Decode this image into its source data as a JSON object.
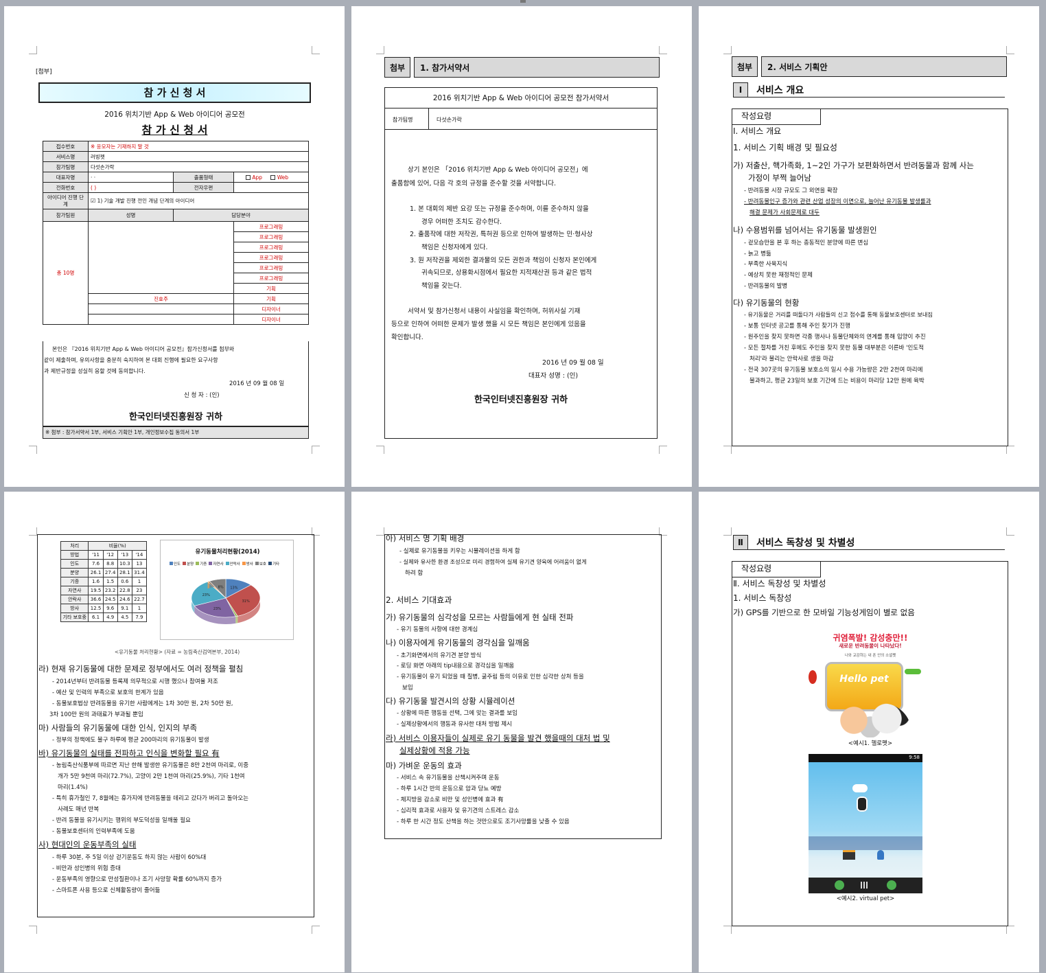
{
  "p1": {
    "attach": "[첨부]",
    "box_title": "참 가 신 청 서",
    "contest": "2016 위치기반 App & Web 아이디어 공모전",
    "title": "참 가 신 청 서",
    "l_receipt": "접수번호",
    "v_receipt": "※ 응모자는 기재하지 말 것",
    "l_service": "서비스명",
    "v_service": "러빙펫",
    "l_team": "참가팀명",
    "v_team": "다섯손가락",
    "l_rep": "대표자명",
    "v_rep": "· ·",
    "l_type": "출품형태",
    "v_app": "App",
    "v_web": "Web",
    "l_phone": "전화번호",
    "v_phone": "(      )",
    "l_email": "전자우편",
    "l_idea": "아이디어 진행 단계",
    "v_idea": "1) 기술 개발 진행 전인 개념 단계의 아이디어",
    "l_member": "참가팀원",
    "h_name": "성명",
    "h_role": "담당분야",
    "count": "총 10명",
    "role_prog": "프로그래밍",
    "role_plan": "기획",
    "role_design": "디자이너",
    "leader": "진효주",
    "pledge1": "본인은 『2016 위치기반 App & Web 아이디어 공모전』참가신청서를 첨부와",
    "pledge2": "같이 제출하며, 유의사항을 충분히 숙지하여 본 대회 진행에 필요한 요구사항",
    "pledge3": "과 제반규정을 성실히 응할 것에 동의합니다.",
    "date": "2016 년   09 월  08 일",
    "applicant": "신   청   자 :                            (인)",
    "to": "한국인터넷진흥원장 귀하",
    "footer": "※ 첨부 : 참가서약서 1부, 서비스 기획안 1부, 개인정보수집 동의서 1부"
  },
  "p2": {
    "tag": "첨부",
    "head": "1. 참가서약서",
    "title": "2016 위치기반 App & Web 아이디어 공모전 참가서약서",
    "l_team": "참가팀명",
    "v_team": "다섯손가락",
    "p1a": "상기 본인은 「2016 위치기반 App & Web 아이디어 공모전」에",
    "p1b": "출품함에 있어, 다음 각 호의  규정을 준수할 것을 서약합니다.",
    "i1a": "1. 본 대회의 제반 요강 또는 규정을 준수하며, 이를 준수하지 않을",
    "i1b": "경우 어떠한 조치도 감수한다.",
    "i2a": "2. 출품작에 대한 저작권, 특허권 등으로 인하여 발생하는 민·형사상",
    "i2b": "책임은 신청자에게 있다.",
    "i3a": "3. 원 저작권을 제외한 결과물의 모든 권한과 책임이 신청자 본인에게",
    "i3b": "귀속되므로, 상용화시점에서 필요한 지적재산권 등과 같은 법적",
    "i3c": "책임을 갖는다.",
    "p2a": "서약서 및 참가신청서 내용이 사실임을 확인하며, 허위사실 기재",
    "p2b": "등으로 인하여 어떠한  문제가 발생 했을 시 모든 책임은 본인에게 있음을",
    "p2c": "확인합니다.",
    "date": "2016  년    09  월     08  일",
    "rep": "대표자  성명 :                 (인)",
    "to": "한국인터넷진흥원장 귀하"
  },
  "p3": {
    "tag": "첨부",
    "head": "2. 서비스 기획안",
    "roman": "Ⅰ",
    "roman_title": "서비스 개요",
    "yoryeong": "작성요령",
    "s1": "Ⅰ. 서비스 개요",
    "s2": "1. 서비스 기획 배경 및 필요성",
    "ga1": "가) 저출산, 핵가족화, 1~2인 가구가 보편화하면서 반려동물과 함께 사는",
    "ga2": "가정이 부쩍 늘어남",
    "ga_b1": "- 반려동물 시장 규모도 그 외연을 확장",
    "ga_b2": "- 반려동물인구 증가와 관련 산업 성장의 이면으로, 늘어난 유기동물 발생률과",
    "ga_b3": "해결 문제가 사회문제로 대두",
    "na": "나) 수용범위를 넘어서는 유기동물 발생원인",
    "na_b1": "- 겉모습만을 본 후 하는 충동적인 분양에 따른 변심",
    "na_b2": "- 늙고 병듦",
    "na_b3": "- 부족한 사육지식",
    "na_b4": "- 예상치 못한 재정적인 문제",
    "na_b5": "- 반려동물의 발병",
    "da": "다) 유기동물의 현황",
    "da_b1": "- 유기동물은 거리를 떠돌다가 사람들의 신고 접수를 통해 동물보호센터로 보내짐",
    "da_b2": "- 보통 인터넷 공고를 통해 주인 찾기가 진행",
    "da_b3": "- 원주인을 찾지 못하면 각종 행사나 동물단체와의 연계를 통해 입양이 추진",
    "da_b4": "- 모든 절차를 거친 후에도 주인을 찾지 못한 동물 대부분은 이른바 '인도적",
    "da_b5": "처리'라 불리는 안락사로 생을 마감",
    "da_b6": "- 전국 307곳의 유기동물 보호소의 일시 수용 가능량은 2만 2천여 마리에",
    "da_b7": "불과하고, 평균 23일의 보호 기간에 드는 비용이 마리당 12만 원에 육박"
  },
  "p4": {
    "table_header": [
      "처리",
      "비율(%)"
    ],
    "table_sub": [
      "방법",
      "'11",
      "'12",
      "'13",
      "'14"
    ],
    "table_rows": [
      [
        "인도",
        "7.6",
        "8.8",
        "10.3",
        "13"
      ],
      [
        "분양",
        "26.1",
        "27.4",
        "28.1",
        "31.4"
      ],
      [
        "기증",
        "1.6",
        "1.5",
        "0.6",
        "1"
      ],
      [
        "자연사",
        "19.5",
        "23.2",
        "22.8",
        "23"
      ],
      [
        "안락사",
        "36.6",
        "24.5",
        "24.6",
        "22.7"
      ],
      [
        "방사",
        "12.5",
        "9.6",
        "9.1",
        "1"
      ],
      [
        "기타 보호중",
        "6.1",
        "4.9",
        "4.5",
        "7.9"
      ]
    ],
    "caption": "<유기동물 처리현황> (자료 = 농림축산검역본부, 2014)",
    "ra": "라) 현재 유기동물에 대한 문제로 정부에서도 여러 정책을 펼침",
    "ra_b1": "- 2014년부터 반려동물 등록제 의무적으로 시행 했으나 참여율 저조",
    "ra_b2": "- 예산 및 인력의 부족으로 보호의 한계가 있음",
    "ra_b3": "- 동물보호법상 반려동물을 유기한 사람에게는 1차 30만 원, 2차 50만       원,",
    "ra_b4": "3차 100만 원의 과태료가 부과될 뿐임",
    "ma": "마) 사람들의 유기동물에 대한 인식, 인지의 부족",
    "ma_b1": "- 정부의 정책에도 불구 하루에 평균 200마리의 유기동물이 발생",
    "ba": "바) 유기동물의 실태를 전파하고 인식을 변화할 필요 有",
    "ba_b1": "- 농림축산식품부에 따르면 지난 한해 발생한 유기동물은 8만 2천여 마리로, 이중",
    "ba_b2": "개가 5만 9천여 마리(72.7%), 고양이 2만 1천여 마리(25.9%), 기타 1천여",
    "ba_b3": "마리(1.4%)",
    "ba_b4": "- 특히 휴가철인 7, 8월에는 휴가지에 반려동물을 데리고 갔다가 버리고 돌아오는",
    "ba_b5": "사례도 매년 반복",
    "ba_b6": "- 반려 동물을 유기시키는 행위의 부도덕성을 일깨울 필요",
    "ba_b7": "- 동물보호센터의 인력부족에 도움",
    "sa": "사) 현대인의 운동부족의 실태",
    "sa_b1": "- 하루 30분, 주 5일 이상 걷기운동도 하지 않는 사람이 60%대",
    "sa_b2": "- 비만과 성인병의 위험 증대",
    "sa_b3": "- 운동부족의 영향으로 만성질환이나 조기 사망할 확률 60%까지 증가",
    "sa_b4": "- 스마트폰 사용 등으로 신체활동량이 줄어듦"
  },
  "chart_data": {
    "type": "pie",
    "title": "유기동물처리현황(2014)",
    "legend": [
      "인도",
      "분양",
      "기증",
      "자연사",
      "안락사",
      "방사",
      "보호",
      "기타"
    ],
    "colors": [
      "#4f81bd",
      "#c0504d",
      "#9bbb59",
      "#8064a2",
      "#4bacc6",
      "#f79646",
      "#7f7f7f",
      "#2c4d75"
    ],
    "values": [
      13,
      31.4,
      1,
      23,
      22.7,
      1,
      7.9
    ],
    "labels": [
      "13%",
      "31%",
      "",
      "23%",
      "23%",
      "",
      "8%"
    ]
  },
  "p5": {
    "a": "아) 서비스 명 기획 배경",
    "a_b1": "- 실제로 유기동물을 키우는 시뮬레이션을 하게 함",
    "a_b2": "- 실제와 유사한 환경 조성으로 미리 경험하여 실제 유기견 양육에 어려움이 없게",
    "a_b3": "하려 함",
    "s2": "2. 서비스 기대효과",
    "ga": "가) 유기동물의 심각성을 모르는 사람들에게 현 실태 전파",
    "ga_b1": "- 유기 동물의 사항에 대한 경계심",
    "na": "나) 이용자에게 유기동물의 경각심을 일깨움",
    "na_b1": "- 초기화면에서의 유기견 분양 방식",
    "na_b2": "- 로딩 화면 아래의 tip내용으로 경각심을 일깨움",
    "na_b3": "- 유기동물이 유기 되었을 때 질병, 굶주림 등의 이유로 인한 심각한 상처 등을",
    "na_b4": "보임",
    "da": "다) 유기동물 발견시의 상황 시뮬레이션",
    "da_b1": "- 상황에 따른 행동을 선택, 그에 맞는 결과를 보임",
    "da_b2": "- 실제상황에서의 행동과 유사한 대처 방법 제시",
    "ra1": "라) 서비스 이용자들이 실제로 유기 동물을 발견 했을때의 대처  법 및",
    "ra2": "실제상황에 적용 가능",
    "ma": "마) 가벼운 운동의 효과",
    "ma_b1": "- 서비스 속 유기동물을 산책시켜주며 운동",
    "ma_b2": "- 하루 1시간 반의 운동으로 암과 당뇨 예방",
    "ma_b3": "- 체지방을 감소로 비만 및 성인병에 효과 有",
    "ma_b4": "- 심리적 효과로 사용자 및 유기견의 스트레스 감소",
    "ma_b5": "- 하루 한 시간 정도 산책을 하는 것만으로도 조기사망률을 낮출 수 있음"
  },
  "p6": {
    "roman": "Ⅱ",
    "roman_title": "서비스 독창성 및 차별성",
    "yoryeong": "작성요령",
    "s1": "Ⅱ. 서비스 독창성 및 차별성",
    "s2": "1. 서비스 독창성",
    "ga": "가) GPS를 기반으로 한 모바일 기능성게임이 별로 없음",
    "img1_title": "귀염폭발! 감성충만!!",
    "img1_sub": "새로운 반려동물이 나타났다!",
    "img1_small": "나와 교감하는 내 폰 안의 소셜펫",
    "img1_logo": "Hello pet",
    "cap1": "<예시1. 헬로펫>",
    "phone_time": "9:58",
    "cap2": "<예시2. virtual pet>"
  }
}
